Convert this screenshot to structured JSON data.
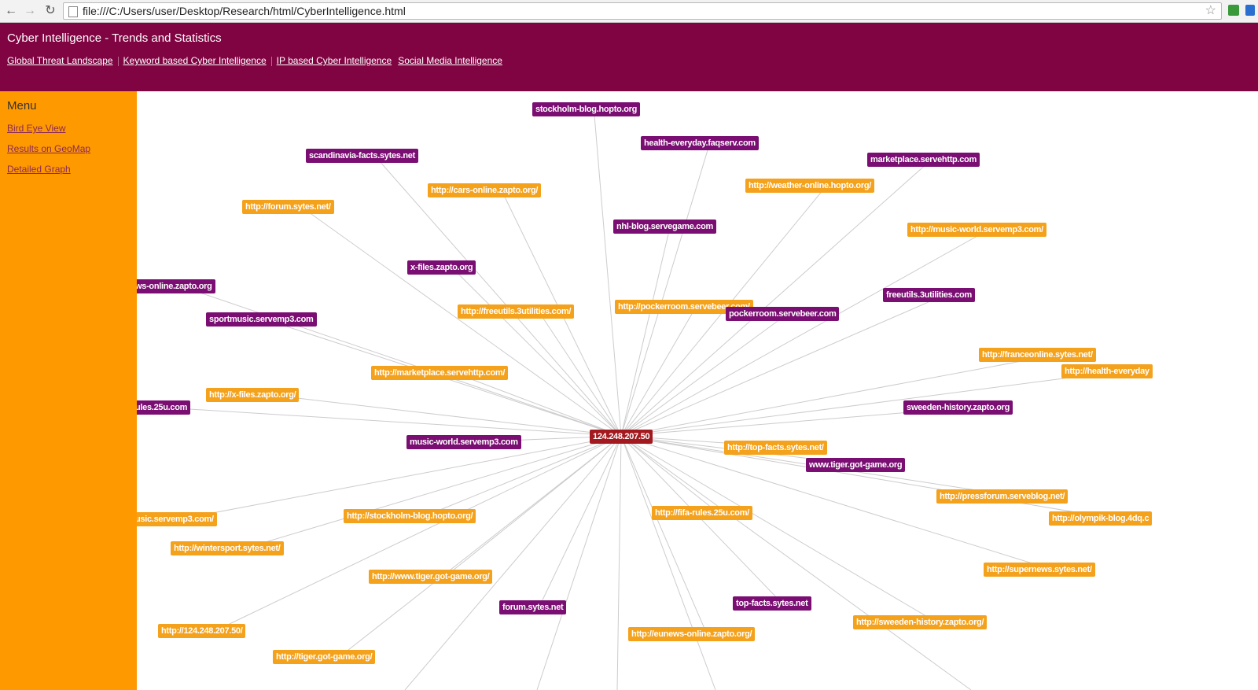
{
  "browser": {
    "url": "file:///C:/Users/user/Desktop/Research/html/CyberIntelligence.html",
    "back_icon": "back-arrow-icon",
    "forward_icon": "forward-arrow-icon",
    "reload_icon": "reload-icon"
  },
  "header": {
    "title": "Cyber Intelligence - Trends and Statistics",
    "background": "#800442",
    "nav": [
      "Global Threat Landscape",
      "Keyword based Cyber Intelligence",
      "IP based Cyber Intelligence",
      "Social Media Intelligence"
    ]
  },
  "sidebar": {
    "title": "Menu",
    "background": "#ff9900",
    "items": [
      "Bird Eye View",
      "Results on GeoMap",
      "Detailed Graph"
    ]
  },
  "graph": {
    "colors": {
      "domain": "#7a0e72",
      "url": "#f4a11b",
      "center": "#a2191f",
      "edge": "#cccccc"
    },
    "center": "124.248.207.50",
    "nodes": [
      {
        "label": "stockholm-blog.hopto.org",
        "kind": "domain"
      },
      {
        "label": "health-everyday.faqserv.com",
        "kind": "domain"
      },
      {
        "label": "scandinavia-facts.sytes.net",
        "kind": "domain"
      },
      {
        "label": "marketplace.servehttp.com",
        "kind": "domain"
      },
      {
        "label": "http://cars-online.zapto.org/",
        "kind": "url"
      },
      {
        "label": "http://weather-online.hopto.org/",
        "kind": "url"
      },
      {
        "label": "http://forum.sytes.net/",
        "kind": "url"
      },
      {
        "label": "nhl-blog.servegame.com",
        "kind": "domain"
      },
      {
        "label": "http://music-world.servemp3.com/",
        "kind": "url"
      },
      {
        "label": "x-files.zapto.org",
        "kind": "domain"
      },
      {
        "label": "ws-online.zapto.org",
        "kind": "domain"
      },
      {
        "label": "freeutils.3utilities.com",
        "kind": "domain"
      },
      {
        "label": "http://freeutils.3utilities.com/",
        "kind": "url"
      },
      {
        "label": "http://pockerroom.servebeer.com/",
        "kind": "url"
      },
      {
        "label": "pockerroom.servebeer.com",
        "kind": "domain"
      },
      {
        "label": "sportmusic.servemp3.com",
        "kind": "domain"
      },
      {
        "label": "http://franceonline.sytes.net/",
        "kind": "url"
      },
      {
        "label": "http://health-everyday",
        "kind": "url"
      },
      {
        "label": "http://marketplace.servehttp.com/",
        "kind": "url"
      },
      {
        "label": "http://x-files.zapto.org/",
        "kind": "url"
      },
      {
        "label": "ules.25u.com",
        "kind": "domain"
      },
      {
        "label": "sweeden-history.zapto.org",
        "kind": "domain"
      },
      {
        "label": "music-world.servemp3.com",
        "kind": "domain"
      },
      {
        "label": "http://top-facts.sytes.net/",
        "kind": "url"
      },
      {
        "label": "www.tiger.got-game.org",
        "kind": "domain"
      },
      {
        "label": "http://pressforum.serveblog.net/",
        "kind": "url"
      },
      {
        "label": "http://fifa-rules.25u.com/",
        "kind": "url"
      },
      {
        "label": "http://stockholm-blog.hopto.org/",
        "kind": "url"
      },
      {
        "label": "usic.servemp3.com/",
        "kind": "url"
      },
      {
        "label": "http://olympik-blog.4dq.c",
        "kind": "url"
      },
      {
        "label": "http://wintersport.sytes.net/",
        "kind": "url"
      },
      {
        "label": "http://supernews.sytes.net/",
        "kind": "url"
      },
      {
        "label": "http://www.tiger.got-game.org/",
        "kind": "url"
      },
      {
        "label": "forum.sytes.net",
        "kind": "domain"
      },
      {
        "label": "top-facts.sytes.net",
        "kind": "domain"
      },
      {
        "label": "http://sweeden-history.zapto.org/",
        "kind": "url"
      },
      {
        "label": "http://124.248.207.50/",
        "kind": "url"
      },
      {
        "label": "http://eunews-online.zapto.org/",
        "kind": "url"
      },
      {
        "label": "http://tiger.got-game.org/",
        "kind": "url"
      }
    ]
  }
}
